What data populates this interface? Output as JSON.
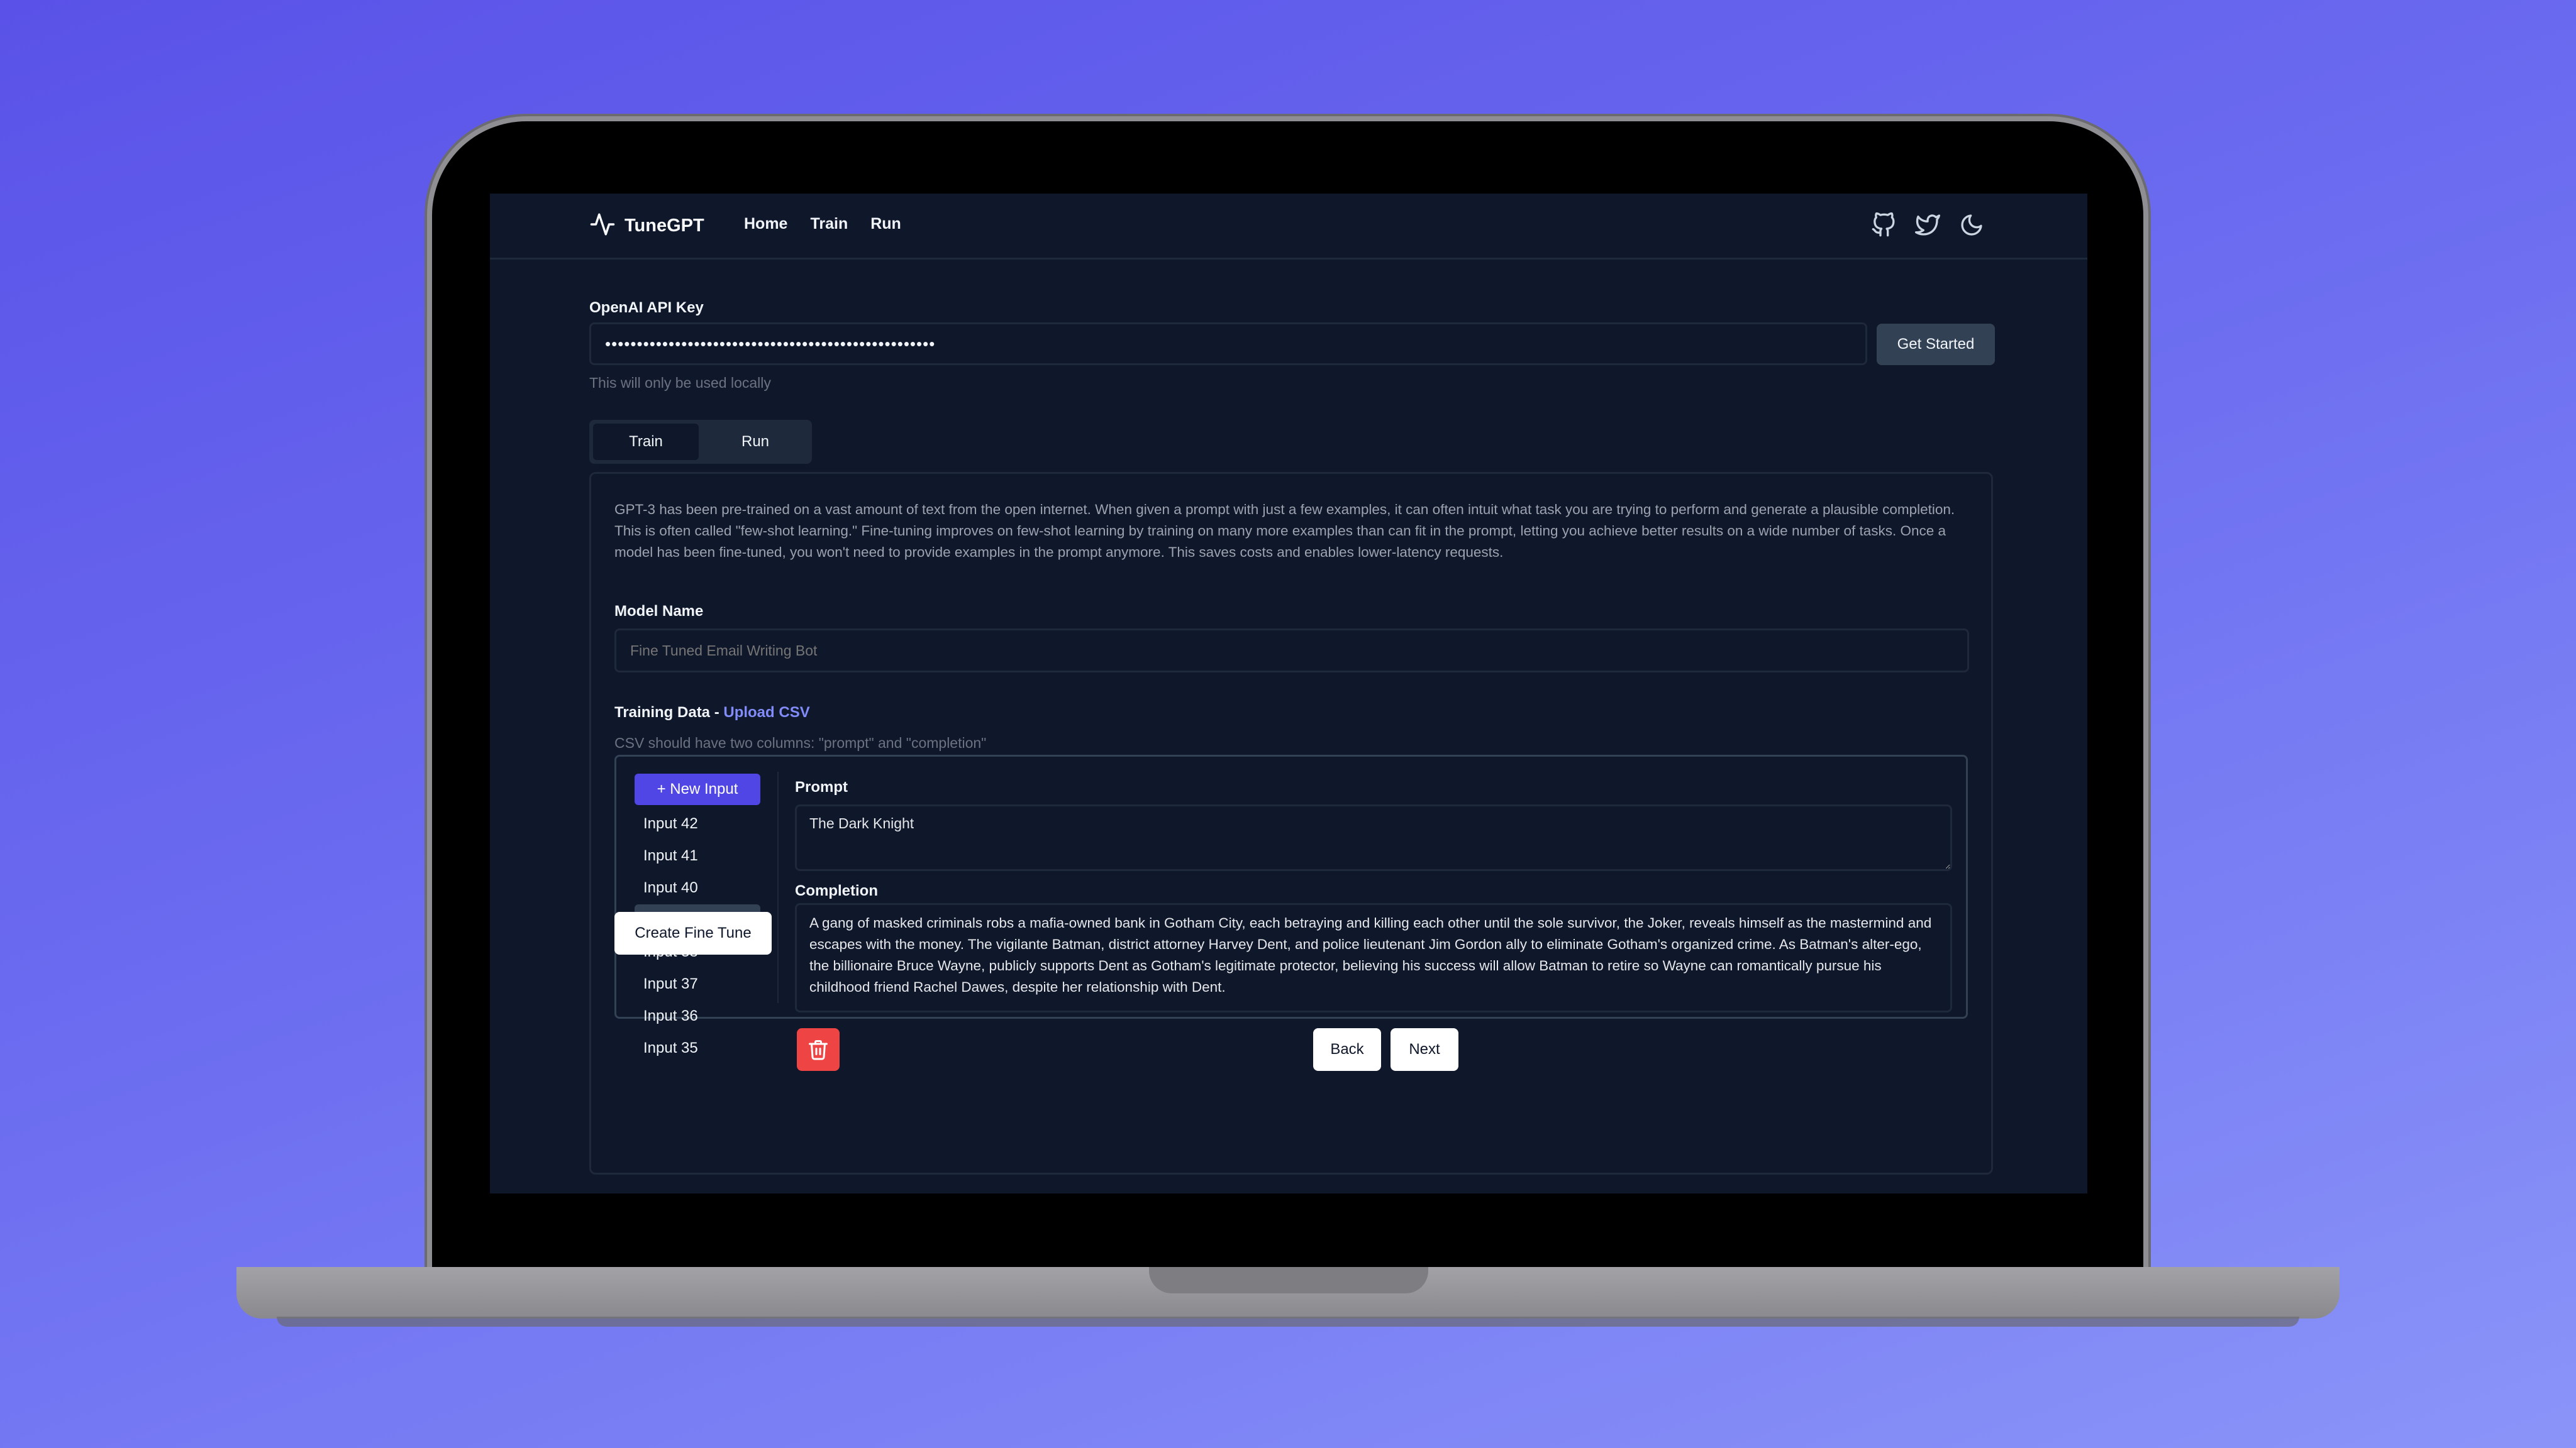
{
  "app": {
    "name": "TuneGPT"
  },
  "nav": {
    "links": [
      "Home",
      "Train",
      "Run"
    ],
    "icons": [
      "github-icon",
      "twitter-icon",
      "moon-icon"
    ]
  },
  "api_key": {
    "label": "OpenAI API Key",
    "value": "••••••••••••••••••••••••••••••••••••••••••••••••••••",
    "button": "Get Started",
    "hint": "This will only be used locally"
  },
  "tabs": [
    {
      "label": "Train",
      "active": true
    },
    {
      "label": "Run",
      "active": false
    }
  ],
  "train": {
    "description": "GPT-3 has been pre-trained on a vast amount of text from the open internet. When given a prompt with just a few examples, it can often intuit what task you are trying to perform and generate a plausible completion. This is often called \"few-shot learning.\" Fine-tuning improves on few-shot learning by training on many more examples than can fit in the prompt, letting you achieve better results on a wide number of tasks. Once a model has been fine-tuned, you won't need to provide examples in the prompt anymore. This saves costs and enables lower-latency requests.",
    "model_name_label": "Model Name",
    "model_name_placeholder": "Fine Tuned Email Writing Bot",
    "training_data_label": "Training Data - ",
    "upload_csv": "Upload CSV",
    "csv_hint": "CSV should have two columns: \"prompt\" and \"completion\"",
    "new_input_button": "+ New Input",
    "inputs": [
      "Input 42",
      "Input 41",
      "Input 40",
      "Input 39",
      "Input 38",
      "Input 37",
      "Input 36",
      "Input 35"
    ],
    "selected_input": "Input 39",
    "prompt_label": "Prompt",
    "prompt_value": "The Dark Knight",
    "completion_label": "Completion",
    "completion_value": "A gang of masked criminals robs a mafia-owned bank in Gotham City, each betraying and killing each other until the sole survivor, the Joker, reveals himself as the mastermind and escapes with the money. The vigilante Batman, district attorney Harvey Dent, and police lieutenant Jim Gordon ally to eliminate Gotham's organized crime. As Batman's alter-ego, the billionaire Bruce Wayne, publicly supports Dent as Gotham's legitimate protector, believing his success will allow Batman to retire so Wayne can romantically pursue his childhood friend Rachel Dawes, despite her relationship with Dent.",
    "back_button": "Back",
    "next_button": "Next",
    "create_button": "Create Fine Tune"
  },
  "colors": {
    "background_gradient_start": "#5a52e8",
    "background_gradient_end": "#8a94f8",
    "screen_bg": "#0f172a",
    "accent": "#4f46e5",
    "link": "#818cf8",
    "danger": "#ef4444"
  }
}
